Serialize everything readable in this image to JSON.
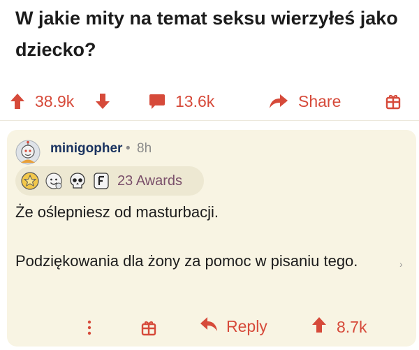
{
  "post": {
    "title": "W jakie mity na temat seksu wierzyłeś jako dziecko?"
  },
  "post_actions": {
    "upvotes": "38.9k",
    "comments": "13.6k",
    "share_label": "Share"
  },
  "comment": {
    "username": "minigopher",
    "separator": "•",
    "age": "8h",
    "awards_label": "23 Awards",
    "award_icons": [
      "gold-star-award-icon",
      "wholesome-face-award-icon",
      "skull-award-icon",
      "f-award-icon"
    ],
    "paragraphs": [
      "Że oślepniesz od masturbacji.",
      "Podziękowania dla żony za pomoc w pisaniu tego."
    ],
    "reply_label": "Reply",
    "upvotes": "8.7k"
  },
  "colors": {
    "accent": "#d64a3a",
    "card_background": "#f8f4e3",
    "username": "#1a3360",
    "awards_text": "#7a4f6a"
  }
}
